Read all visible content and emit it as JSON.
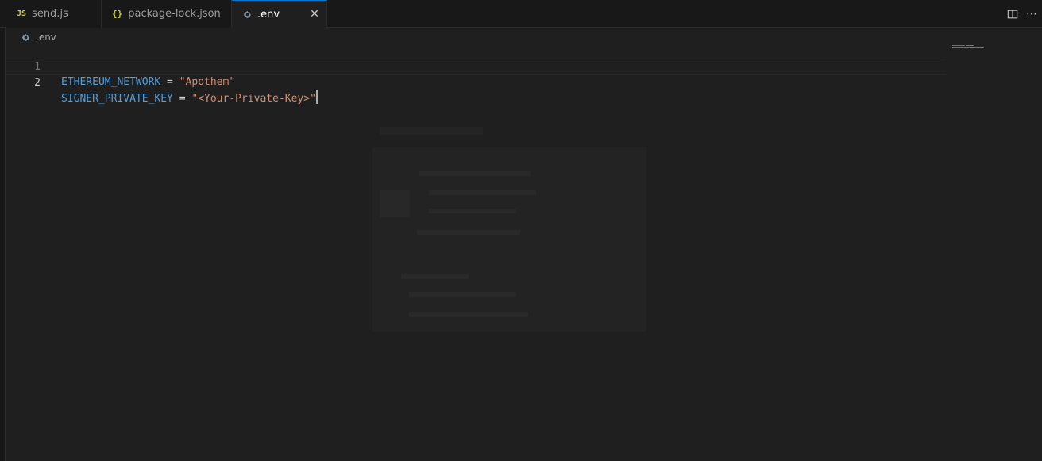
{
  "tabs": [
    {
      "icon": "JS",
      "label": "send.js",
      "active": false
    },
    {
      "icon": "{}",
      "label": "package-lock.json",
      "active": false
    },
    {
      "icon": "gear",
      "label": ".env",
      "active": true
    }
  ],
  "tab_close_symbol": "✕",
  "breadcrumb": {
    "file": ".env"
  },
  "editor": {
    "lines": [
      {
        "number": "1",
        "key": "ETHEREUM_NETWORK",
        "op": " = ",
        "value": "\"Apothem\""
      },
      {
        "number": "2",
        "key": "SIGNER_PRIVATE_KEY",
        "op": " = ",
        "value": "\"<Your-Private-Key>\""
      }
    ],
    "current_line": 2
  },
  "actions": {
    "split_editor": "split-editor-icon",
    "more_actions": "⋯"
  },
  "colors": {
    "key": "#569cd6",
    "string": "#ce9178",
    "js_icon": "#cbcb41",
    "active_tab_border": "#0078d4"
  }
}
